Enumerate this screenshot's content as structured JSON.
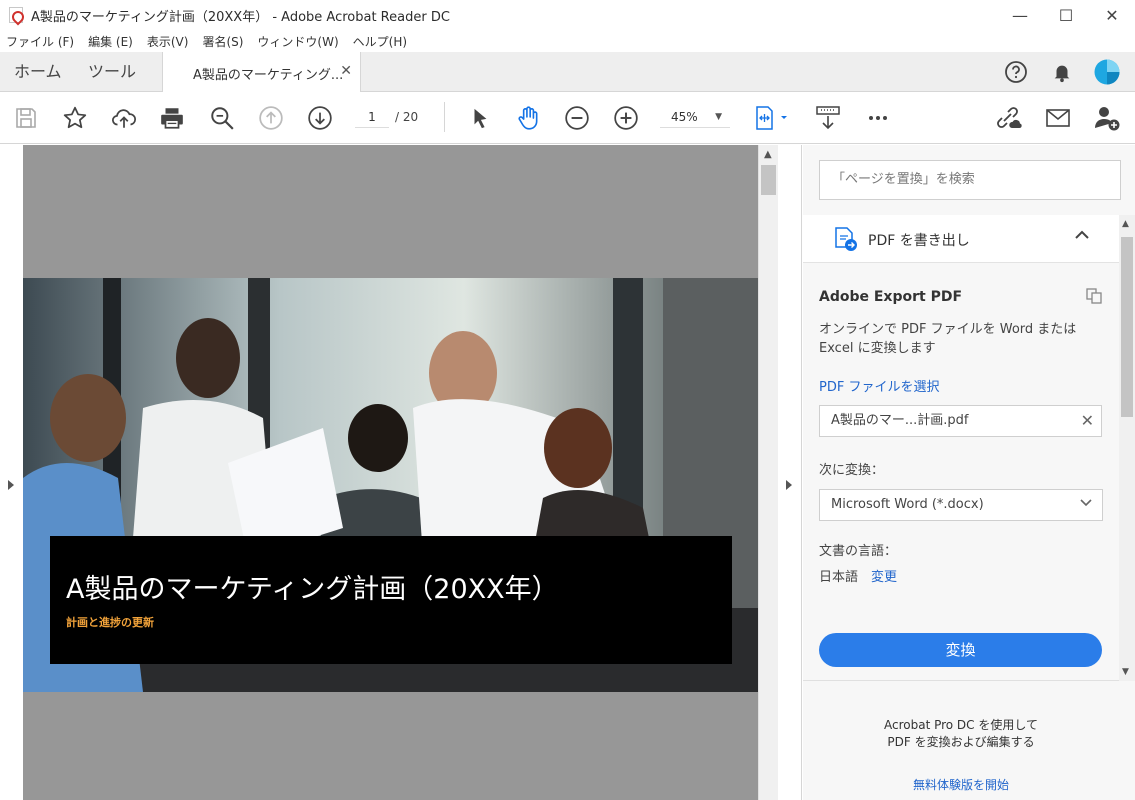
{
  "window": {
    "title": "A製品のマーケティング計画（20XX年） - Adobe Acrobat Reader DC",
    "minimize": "—",
    "maximize": "☐",
    "close": "✕"
  },
  "menu": [
    "ファイル (F)",
    "編集 (E)",
    "表示(V)",
    "署名(S)",
    "ウィンドウ(W)",
    "ヘルプ(H)"
  ],
  "tabs": {
    "home": "ホーム",
    "tools": "ツール",
    "document": "A製品のマーケティング...",
    "close": "✕"
  },
  "toolbar": {
    "page_current": "1",
    "page_total": "/  20",
    "zoom": "45%",
    "zoom_caret": "▼"
  },
  "document": {
    "slide_title": "A製品のマーケティング計画（20XX年）",
    "slide_subtitle": "計画と進捗の更新"
  },
  "right_pane": {
    "search_placeholder": "「ページを置換」を検索",
    "export_header": "PDF を書き出し",
    "export_title": "Adobe Export PDF",
    "export_description": "オンラインで PDF ファイルを Word または Excel に変換します",
    "select_file_link": "PDF ファイルを選択",
    "selected_file": "A製品のマー...計画.pdf",
    "convert_to_label": "次に変換：",
    "convert_to_value": "Microsoft Word (*.docx)",
    "doc_language_label": "文書の言語：",
    "doc_language_value": "日本語",
    "doc_language_change": "変更",
    "convert_button": "変換",
    "promo_line1": "Acrobat Pro DC を使用して",
    "promo_line2": "PDF を変換および編集する",
    "promo_link": "無料体験版を開始"
  },
  "colors": {
    "accent": "#2b7de9",
    "link": "#2266cc",
    "subtitle": "#f2a33a",
    "avatar": "#1ea7e1"
  }
}
